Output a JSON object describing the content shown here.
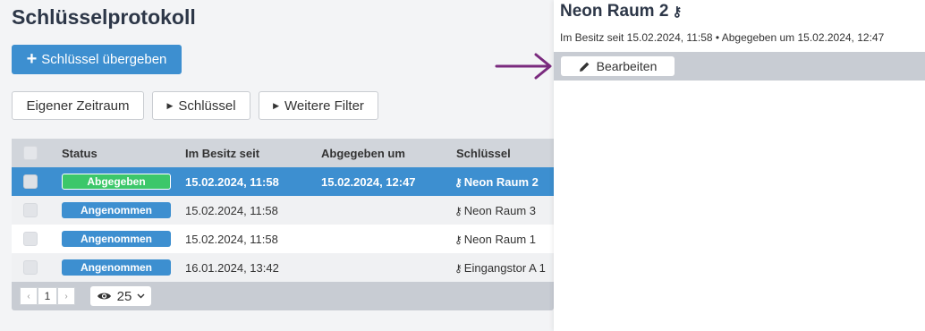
{
  "page": {
    "title": "Schlüsselprotokoll"
  },
  "actions": {
    "hand_over_label": "Schlüssel übergeben"
  },
  "filters": {
    "own_period": "Eigener Zeitraum",
    "keys": "Schlüssel",
    "more_filters": "Weitere Filter"
  },
  "table": {
    "columns": [
      "Status",
      "Im Besitz seit",
      "Abgegeben um",
      "Schlüssel"
    ],
    "rows": [
      {
        "status": "Abgegeben",
        "status_color": "#3cc76a",
        "since": "15.02.2024, 11:58",
        "returned": "15.02.2024, 12:47",
        "key": "Neon Raum 2"
      },
      {
        "status": "Angenommen",
        "status_color": "#3d8fd0",
        "since": "15.02.2024, 11:58",
        "returned": "",
        "key": "Neon Raum 3"
      },
      {
        "status": "Angenommen",
        "status_color": "#3d8fd0",
        "since": "15.02.2024, 11:58",
        "returned": "",
        "key": "Neon Raum 1"
      },
      {
        "status": "Angenommen",
        "status_color": "#3d8fd0",
        "since": "16.01.2024, 13:42",
        "returned": "",
        "key": "Eingangstor A 1"
      }
    ]
  },
  "pagination": {
    "current_page": "1",
    "per_page": "25"
  },
  "detail_panel": {
    "title": "Neon Raum 2",
    "meta": "Im Besitz seit 15.02.2024, 11:58  •  Abgegeben um 15.02.2024, 12:47",
    "edit_label": "Bearbeiten"
  },
  "colors": {
    "accent": "#3d8fd0",
    "success": "#3cc76a",
    "arrow": "#7a2a7e"
  }
}
